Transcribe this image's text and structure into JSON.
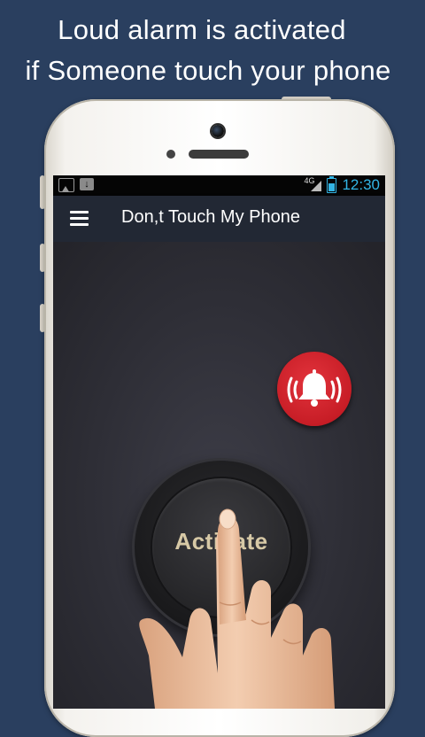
{
  "promo": {
    "line1": "Loud alarm is activated",
    "line2": "if Someone touch your phone"
  },
  "statusbar": {
    "network": "4G",
    "time": "12:30"
  },
  "appbar": {
    "title": "Don,t Touch My Phone",
    "menu_icon": "hamburger-menu-icon"
  },
  "main": {
    "activate_label": "Activate",
    "alarm_icon": "alarm-bell-icon"
  },
  "colors": {
    "background": "#2a3f5f",
    "appbar": "#222834",
    "statusbar_accent": "#33b5e5",
    "alarm_red": "#c71d26",
    "activate_text": "#d7c9a6"
  }
}
